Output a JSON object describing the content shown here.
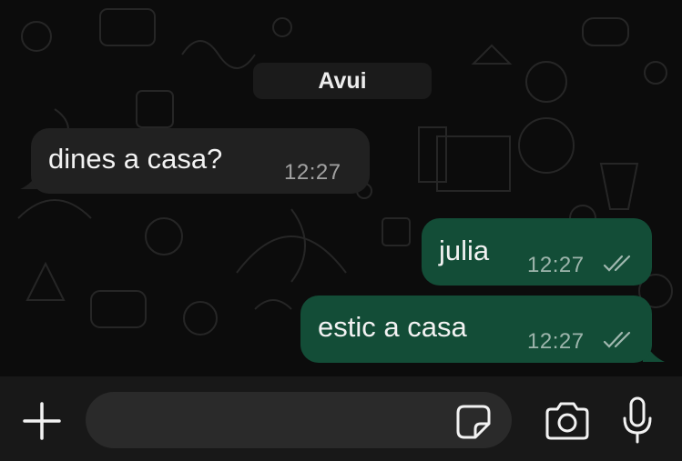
{
  "chat": {
    "date_separator": "Avui",
    "messages": [
      {
        "direction": "incoming",
        "text": "dines a casa?",
        "time": "12:27"
      },
      {
        "direction": "outgoing",
        "text": "julia",
        "time": "12:27",
        "status": "read"
      },
      {
        "direction": "outgoing",
        "text": "estic a casa",
        "time": "12:27",
        "status": "read"
      }
    ]
  },
  "composer": {
    "value": "",
    "icons": [
      "plus-icon",
      "sticker-icon",
      "camera-icon",
      "microphone-icon"
    ]
  },
  "colors": {
    "incoming_bubble": "#212121",
    "outgoing_bubble": "#134d37",
    "background": "#0c0c0c"
  }
}
